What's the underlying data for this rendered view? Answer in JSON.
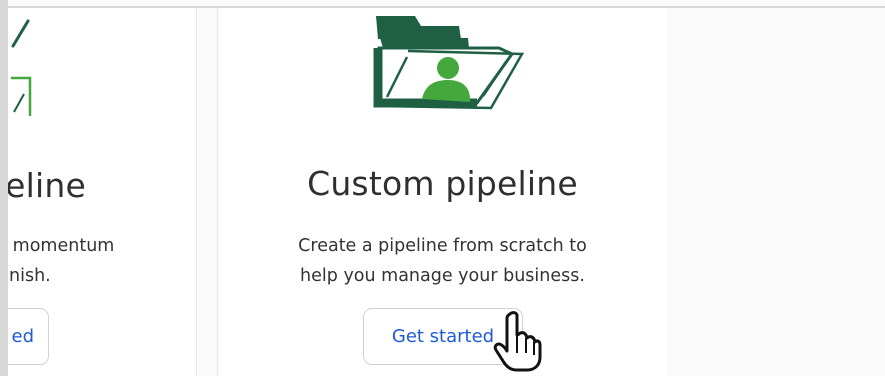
{
  "cards": [
    {
      "title_visible": "peline",
      "description_lines": [
        "s momentum",
        "finish."
      ],
      "button_label": "ed"
    },
    {
      "title": "Custom pipeline",
      "description_lines": [
        "Create a pipeline from scratch to",
        "help you manage your business."
      ],
      "button_label": "Get started",
      "icon": "custom-folder-icon"
    }
  ],
  "colors": {
    "accent_green": "#1f6045",
    "light_green": "#45a83d",
    "button_text_blue": "#1f59d6",
    "title_text": "#2f2f2f"
  },
  "cursor": {
    "icon": "hand-pointer-icon"
  }
}
